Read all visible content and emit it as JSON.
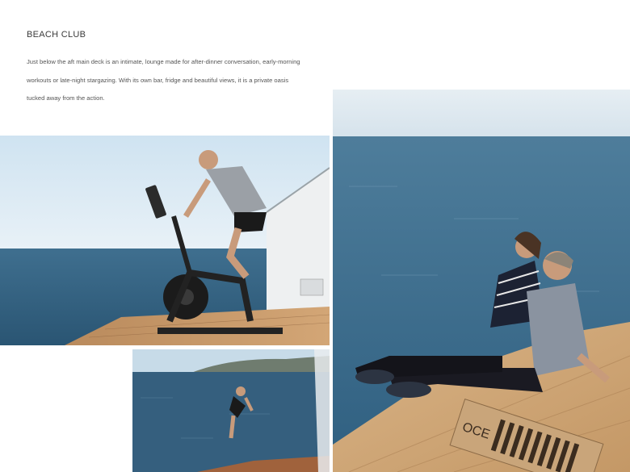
{
  "section": {
    "title": "BEACH CLUB",
    "description": "Just below the aft main deck is an intimate, lounge made for after-dinner conversation, early-morning workouts or late-night stargazing. With its own bar, fridge and beautiful views, it is a private oasis tucked away from the action."
  },
  "photos": {
    "couple": {
      "deck_lettering": "OCE"
    }
  }
}
